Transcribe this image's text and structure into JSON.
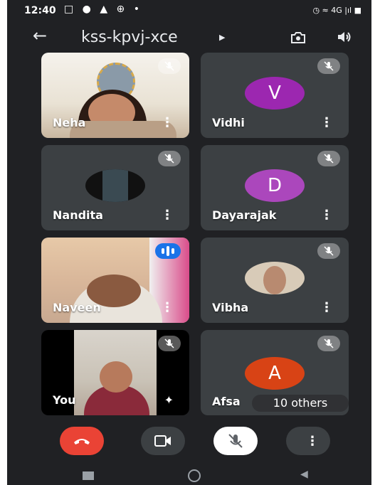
{
  "status_bar": {
    "time": "12:40",
    "icons_left": "□ ● ▲ ⊕ •",
    "icons_right": "◷ ≈ 4G |ıl ■"
  },
  "header": {
    "meeting_code": "kss-kpvj-xce"
  },
  "participants": [
    {
      "name": "Neha",
      "kind": "video",
      "muted": true
    },
    {
      "name": "Vidhi",
      "kind": "avatar",
      "initial": "V",
      "color": "#9c27b0",
      "muted": true
    },
    {
      "name": "Nandita",
      "kind": "photo",
      "muted": true
    },
    {
      "name": "Dayarajak",
      "kind": "avatar",
      "initial": "D",
      "color": "#ab47bc",
      "muted": true
    },
    {
      "name": "Naveen",
      "kind": "video",
      "speaking": true
    },
    {
      "name": "Vibha",
      "kind": "photo",
      "muted": true
    },
    {
      "name": "You",
      "kind": "video",
      "muted": true
    },
    {
      "name": "Afsa",
      "kind": "avatar",
      "initial": "A",
      "color": "#d84315",
      "muted": true
    }
  ],
  "others_badge": "10 others",
  "controls": {
    "end_call_color": "#ea4335"
  }
}
